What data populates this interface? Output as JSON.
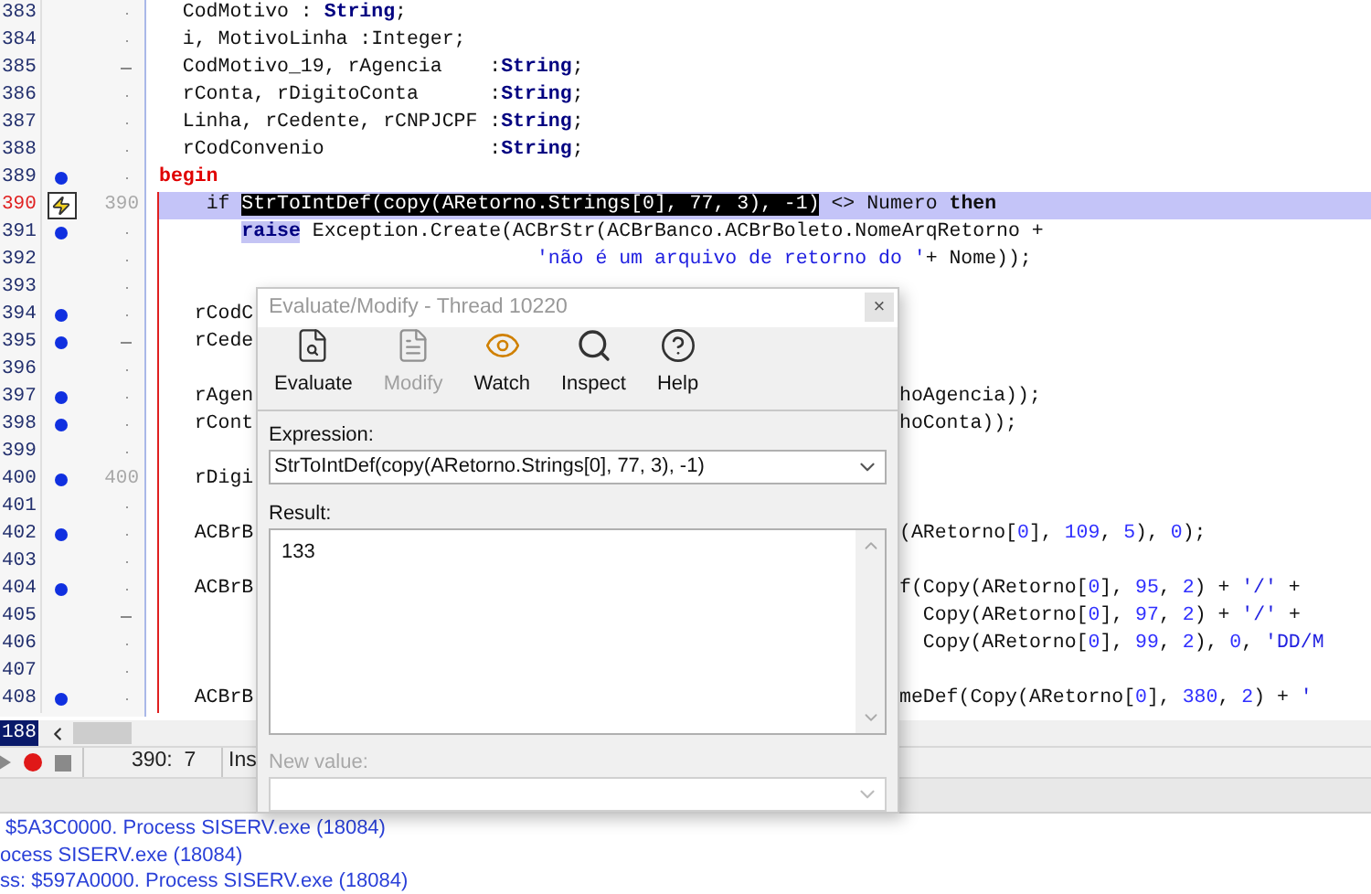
{
  "editor": {
    "lines": [
      {
        "number": "383",
        "current": false,
        "breakpoint": false,
        "execution": false,
        "fold": {
          "kind": "dot"
        },
        "tokens": [
          {
            "kind": "plain",
            "text": "  CodMotivo : "
          },
          {
            "kind": "type",
            "text": "String"
          },
          {
            "kind": "plain",
            "text": ";"
          }
        ]
      },
      {
        "number": "384",
        "current": false,
        "breakpoint": false,
        "execution": false,
        "fold": {
          "kind": "dot"
        },
        "tokens": [
          {
            "kind": "plain",
            "text": "  i, MotivoLinha :Integer;"
          }
        ]
      },
      {
        "number": "385",
        "current": false,
        "breakpoint": false,
        "execution": false,
        "fold": {
          "kind": "dash"
        },
        "tokens": [
          {
            "kind": "plain",
            "text": "  CodMotivo_19, rAgencia    :"
          },
          {
            "kind": "type",
            "text": "String"
          },
          {
            "kind": "plain",
            "text": ";"
          }
        ]
      },
      {
        "number": "386",
        "current": false,
        "breakpoint": false,
        "execution": false,
        "fold": {
          "kind": "dot"
        },
        "tokens": [
          {
            "kind": "plain",
            "text": "  rConta, rDigitoConta      :"
          },
          {
            "kind": "type",
            "text": "String"
          },
          {
            "kind": "plain",
            "text": ";"
          }
        ]
      },
      {
        "number": "387",
        "current": false,
        "breakpoint": false,
        "execution": false,
        "fold": {
          "kind": "dot"
        },
        "tokens": [
          {
            "kind": "plain",
            "text": "  Linha, rCedente, rCNPJCPF :"
          },
          {
            "kind": "type",
            "text": "String"
          },
          {
            "kind": "plain",
            "text": ";"
          }
        ]
      },
      {
        "number": "388",
        "current": false,
        "breakpoint": false,
        "execution": false,
        "fold": {
          "kind": "dot"
        },
        "tokens": [
          {
            "kind": "plain",
            "text": "  rCodConvenio              :"
          },
          {
            "kind": "type",
            "text": "String"
          },
          {
            "kind": "plain",
            "text": ";"
          }
        ]
      },
      {
        "number": "389",
        "current": false,
        "breakpoint": true,
        "execution": false,
        "block_start": true,
        "fold": {
          "kind": "dot"
        },
        "tokens": [
          {
            "kind": "begin",
            "text": "begin"
          }
        ]
      },
      {
        "number": "390",
        "current": true,
        "breakpoint": false,
        "execution": true,
        "fold": {
          "kind": "label",
          "text": "390"
        },
        "tokens": [
          {
            "kind": "plain",
            "text": "    if "
          },
          {
            "kind": "selected",
            "text": "StrToIntDef(copy(ARetorno.Strings[0], 77, 3), -1)"
          },
          {
            "kind": "plain",
            "text": " <> Numero "
          },
          {
            "kind": "keyword",
            "text": "then"
          }
        ]
      },
      {
        "number": "391",
        "current": false,
        "breakpoint": true,
        "execution": false,
        "fold": {
          "kind": "dot"
        },
        "tokens": [
          {
            "kind": "marked",
            "text": "       raise"
          },
          {
            "kind": "plain",
            "text": " Exception.Create(ACBrStr(ACBrBanco.ACBrBoleto.NomeArqRetorno +"
          }
        ]
      },
      {
        "number": "392",
        "current": false,
        "breakpoint": false,
        "execution": false,
        "fold": {
          "kind": "dot"
        },
        "tokens": [
          {
            "kind": "string",
            "text": "                                'não é um arquivo de retorno do '"
          },
          {
            "kind": "plain",
            "text": "+ Nome));"
          }
        ]
      },
      {
        "number": "393",
        "current": false,
        "breakpoint": false,
        "execution": false,
        "fold": {
          "kind": "dot"
        }
      },
      {
        "number": "394",
        "current": false,
        "breakpoint": true,
        "execution": false,
        "fold": {
          "kind": "dot"
        },
        "tokens": [
          {
            "kind": "plain",
            "text": "   rCodC"
          }
        ]
      },
      {
        "number": "395",
        "current": false,
        "breakpoint": true,
        "execution": false,
        "fold": {
          "kind": "dash"
        },
        "tokens": [
          {
            "kind": "plain",
            "text": "   rCede"
          }
        ]
      },
      {
        "number": "396",
        "current": false,
        "breakpoint": false,
        "execution": false,
        "fold": {
          "kind": "dot"
        }
      },
      {
        "number": "397",
        "current": false,
        "breakpoint": true,
        "execution": false,
        "fold": {
          "kind": "dot"
        },
        "tokens": [
          {
            "kind": "plain",
            "text": "   rAgen"
          }
        ],
        "tail": [
          {
            "kind": "plain",
            "text": "hoAgencia));"
          }
        ]
      },
      {
        "number": "398",
        "current": false,
        "breakpoint": true,
        "execution": false,
        "fold": {
          "kind": "dot"
        },
        "tokens": [
          {
            "kind": "plain",
            "text": "   rCont"
          }
        ],
        "tail": [
          {
            "kind": "plain",
            "text": "hoConta));"
          }
        ]
      },
      {
        "number": "399",
        "current": false,
        "breakpoint": false,
        "execution": false,
        "fold": {
          "kind": "dot"
        }
      },
      {
        "number": "400",
        "current": false,
        "breakpoint": true,
        "execution": false,
        "fold": {
          "kind": "label",
          "text": "400"
        },
        "tokens": [
          {
            "kind": "plain",
            "text": "   rDigi"
          }
        ]
      },
      {
        "number": "401",
        "current": false,
        "breakpoint": false,
        "execution": false,
        "fold": {
          "kind": "dot"
        }
      },
      {
        "number": "402",
        "current": false,
        "breakpoint": true,
        "execution": false,
        "fold": {
          "kind": "dot"
        },
        "tokens": [
          {
            "kind": "plain",
            "text": "   ACBrB"
          }
        ],
        "tail": [
          {
            "kind": "plain",
            "text": "(ARetorno["
          },
          {
            "kind": "number",
            "text": "0"
          },
          {
            "kind": "plain",
            "text": "], "
          },
          {
            "kind": "number",
            "text": "109"
          },
          {
            "kind": "plain",
            "text": ", "
          },
          {
            "kind": "number",
            "text": "5"
          },
          {
            "kind": "plain",
            "text": "), "
          },
          {
            "kind": "number",
            "text": "0"
          },
          {
            "kind": "plain",
            "text": ");"
          }
        ]
      },
      {
        "number": "403",
        "current": false,
        "breakpoint": false,
        "execution": false,
        "fold": {
          "kind": "dot"
        }
      },
      {
        "number": "404",
        "current": false,
        "breakpoint": true,
        "execution": false,
        "fold": {
          "kind": "dot"
        },
        "tokens": [
          {
            "kind": "plain",
            "text": "   ACBrB"
          }
        ],
        "tail": [
          {
            "kind": "plain",
            "text": "f(Copy(ARetorno["
          },
          {
            "kind": "number",
            "text": "0"
          },
          {
            "kind": "plain",
            "text": "], "
          },
          {
            "kind": "number",
            "text": "95"
          },
          {
            "kind": "plain",
            "text": ", "
          },
          {
            "kind": "number",
            "text": "2"
          },
          {
            "kind": "plain",
            "text": ") + "
          },
          {
            "kind": "string",
            "text": "'/'"
          },
          {
            "kind": "plain",
            "text": " +"
          }
        ]
      },
      {
        "number": "405",
        "current": false,
        "breakpoint": false,
        "execution": false,
        "fold": {
          "kind": "dash"
        },
        "tail": [
          {
            "kind": "plain",
            "text": "  Copy(ARetorno["
          },
          {
            "kind": "number",
            "text": "0"
          },
          {
            "kind": "plain",
            "text": "], "
          },
          {
            "kind": "number",
            "text": "97"
          },
          {
            "kind": "plain",
            "text": ", "
          },
          {
            "kind": "number",
            "text": "2"
          },
          {
            "kind": "plain",
            "text": ") + "
          },
          {
            "kind": "string",
            "text": "'/'"
          },
          {
            "kind": "plain",
            "text": " +"
          }
        ]
      },
      {
        "number": "406",
        "current": false,
        "breakpoint": false,
        "execution": false,
        "fold": {
          "kind": "dot"
        },
        "tail": [
          {
            "kind": "plain",
            "text": "  Copy(ARetorno["
          },
          {
            "kind": "number",
            "text": "0"
          },
          {
            "kind": "plain",
            "text": "], "
          },
          {
            "kind": "number",
            "text": "99"
          },
          {
            "kind": "plain",
            "text": ", "
          },
          {
            "kind": "number",
            "text": "2"
          },
          {
            "kind": "plain",
            "text": "), "
          },
          {
            "kind": "number",
            "text": "0"
          },
          {
            "kind": "plain",
            "text": ", "
          },
          {
            "kind": "string",
            "text": "'DD/M"
          }
        ]
      },
      {
        "number": "407",
        "current": false,
        "breakpoint": false,
        "execution": false,
        "fold": {
          "kind": "dot"
        }
      },
      {
        "number": "408",
        "current": false,
        "breakpoint": true,
        "execution": false,
        "fold": {
          "kind": "dot"
        },
        "tokens": [
          {
            "kind": "plain",
            "text": "   ACBrB"
          }
        ],
        "tail": [
          {
            "kind": "plain",
            "text": "meDef(Copy(ARetorno["
          },
          {
            "kind": "number",
            "text": "0"
          },
          {
            "kind": "plain",
            "text": "], "
          },
          {
            "kind": "number",
            "text": "380"
          },
          {
            "kind": "plain",
            "text": ", "
          },
          {
            "kind": "number",
            "text": "2"
          },
          {
            "kind": "plain",
            "text": ") + "
          },
          {
            "kind": "string",
            "text": "'"
          }
        ]
      }
    ],
    "line_indicator": "188"
  },
  "status_bar": {
    "position": "390:  7",
    "mode": "Ins"
  },
  "messages": [
    " $5A3C0000. Process SISERV.exe (18084)",
    "ocess SISERV.exe (18084)",
    "ss: $597A0000. Process SISERV.exe (18084)"
  ],
  "dialog": {
    "title": "Evaluate/Modify - Thread 10220",
    "close": "×",
    "toolbar": [
      {
        "label": "Evaluate",
        "disabled": false
      },
      {
        "label": "Modify",
        "disabled": true
      },
      {
        "label": "Watch",
        "disabled": false
      },
      {
        "label": "Inspect",
        "disabled": false
      },
      {
        "label": "Help",
        "disabled": false
      }
    ],
    "expression_label": "Expression:",
    "expression": "StrToIntDef(copy(ARetorno.Strings[0], 77, 3), -1)",
    "result_label": "Result:",
    "result": "133",
    "new_value_label": "New value:",
    "new_value_disabled": true
  }
}
